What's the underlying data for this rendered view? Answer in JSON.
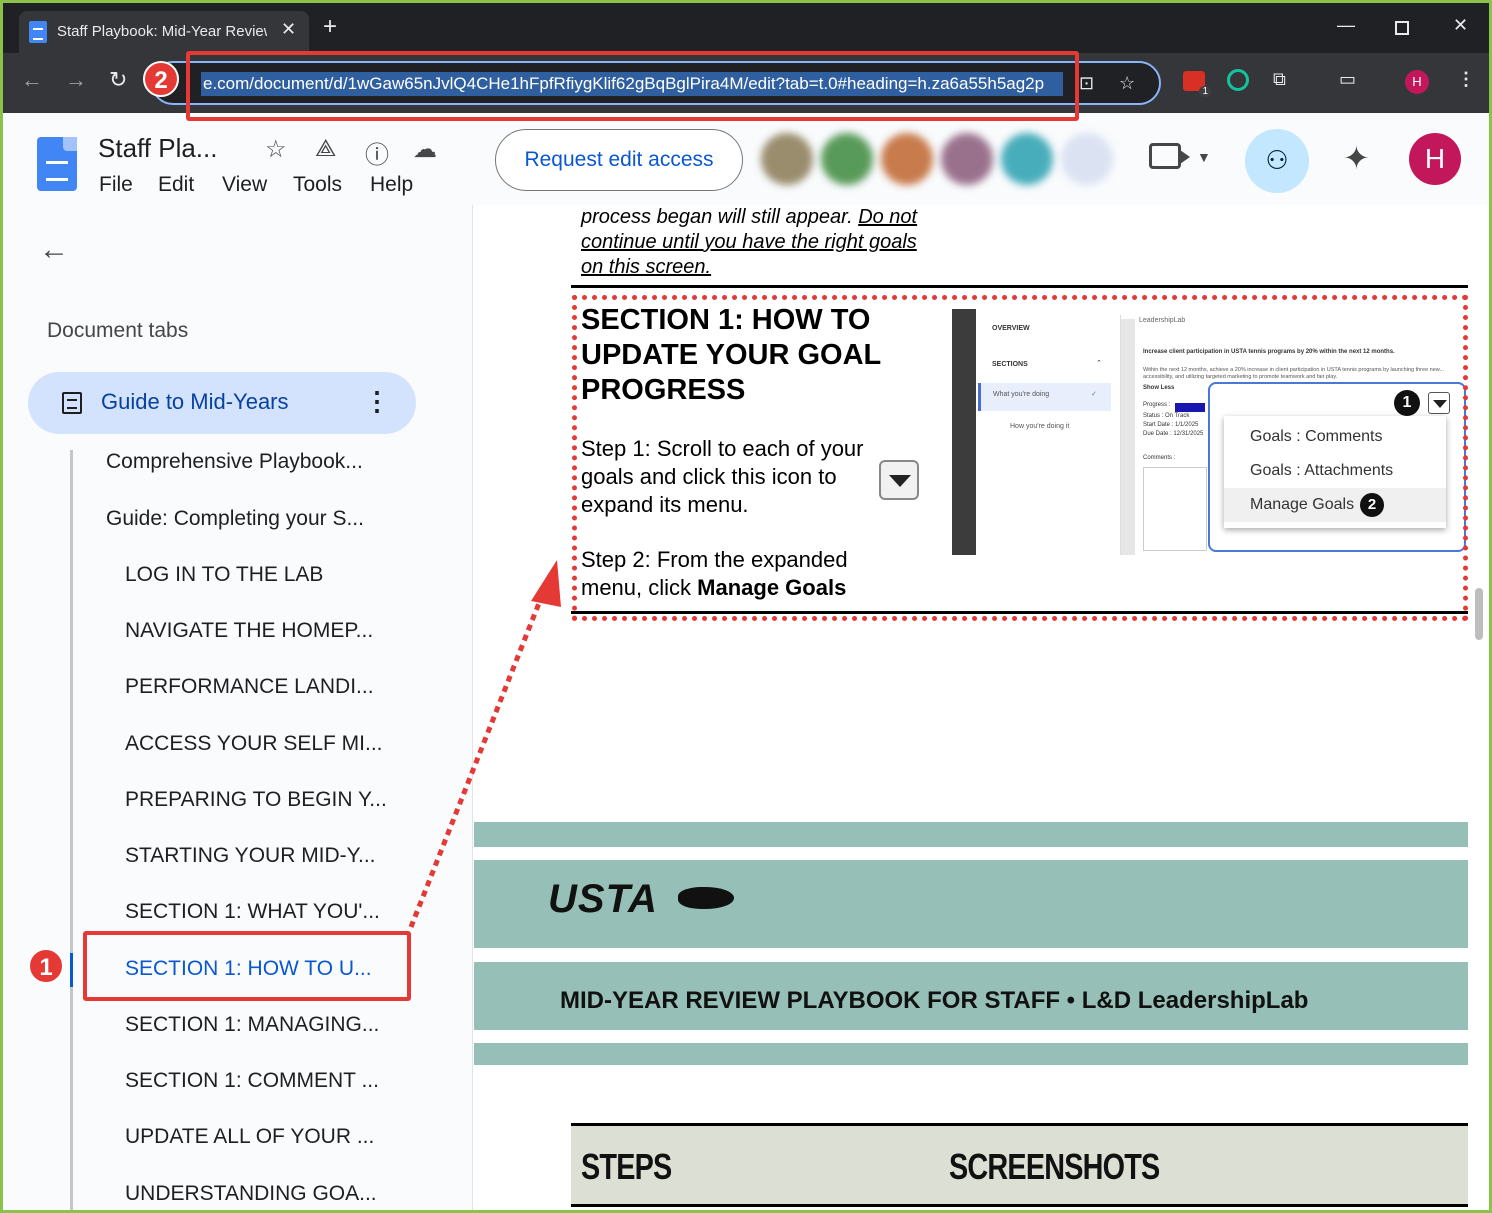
{
  "browser": {
    "tab_title": "Staff Playbook: Mid-Year Review",
    "url": "e.com/document/d/1wGaw65nJvlQ4CHe1hFpfRfiygKlif62gBqBglPira4M/edit?tab=t.0#heading=h.za6a55h5ag2p",
    "extension_badge_count": "1",
    "profile_initial": "H"
  },
  "docs": {
    "title": "Staff Pla...",
    "menu": [
      "File",
      "Edit",
      "View",
      "Tools",
      "Help"
    ],
    "request_edit_label": "Request edit access",
    "profile_initial": "H",
    "brand_color": "#4285f4"
  },
  "sidebar": {
    "heading": "Document tabs",
    "active_tab": "Guide to Mid-Years",
    "outline": [
      {
        "label": "Comprehensive Playbook...",
        "level": 1
      },
      {
        "label": "Guide: Completing your S...",
        "level": 1
      },
      {
        "label": "LOG IN TO THE LAB",
        "level": 2
      },
      {
        "label": "NAVIGATE THE HOMEP...",
        "level": 2
      },
      {
        "label": "PERFORMANCE LANDI...",
        "level": 2
      },
      {
        "label": "ACCESS YOUR SELF MI...",
        "level": 2
      },
      {
        "label": "PREPARING TO BEGIN Y...",
        "level": 2
      },
      {
        "label": "STARTING YOUR MID-Y...",
        "level": 2
      },
      {
        "label": "SECTION 1: WHAT YOU'...",
        "level": 2
      },
      {
        "label": "SECTION 1: HOW TO U...",
        "level": 2,
        "active": true
      },
      {
        "label": "SECTION 1: MANAGING...",
        "level": 2
      },
      {
        "label": "SECTION 1: COMMENT ...",
        "level": 2
      },
      {
        "label": "UPDATE ALL OF YOUR ...",
        "level": 2
      },
      {
        "label": "UNDERSTANDING GOA...",
        "level": 2
      }
    ]
  },
  "document": {
    "top_text_plain": "process began will still appear. ",
    "top_text_underlined": "Do not continue until you have the right goals on this screen.",
    "section_title": "SECTION 1: HOW TO UPDATE YOUR GOAL PROGRESS",
    "step1": "Step 1: Scroll to each of your goals and click this icon to expand its menu.",
    "step2_prefix": "Step 2: From the expanded menu, click ",
    "step2_bold": "Manage Goals",
    "screenshot": {
      "overview": "OVERVIEW",
      "sections": "SECTIONS",
      "item1": "What you're doing",
      "item2": "How you're doing it",
      "brand": "LeadershipLab",
      "goal_title": "Increase client participation in USTA tennis programs by 20% within the next 12 months.",
      "goal_desc": "Within the next 12 months, achieve a 20% increase in client participation in USTA tennis programs by launching three new... accessibility, and utilizing targeted marketing to promote teamwork and fair play.",
      "show_less": "Show Less",
      "progress_label": "Progress :",
      "progress_value": 0.25,
      "status": "Status : On Track",
      "start_date": "Start Date : 1/1/2025",
      "due_date": "Due Date : 12/31/2025",
      "comments": "Comments :",
      "menu_items": [
        "Goals : Comments",
        "Goals : Attachments",
        "Manage Goals"
      ],
      "badge1": "1",
      "badge2": "2"
    },
    "footer_brand": "USTA",
    "footer_title": "MID-YEAR REVIEW PLAYBOOK FOR STAFF • L&D LeadershipLab",
    "col_steps": "STEPS",
    "col_screenshots": "SCREENSHOTS"
  },
  "annotations": {
    "marker1": "1",
    "marker2": "2",
    "color": "#e53935"
  }
}
